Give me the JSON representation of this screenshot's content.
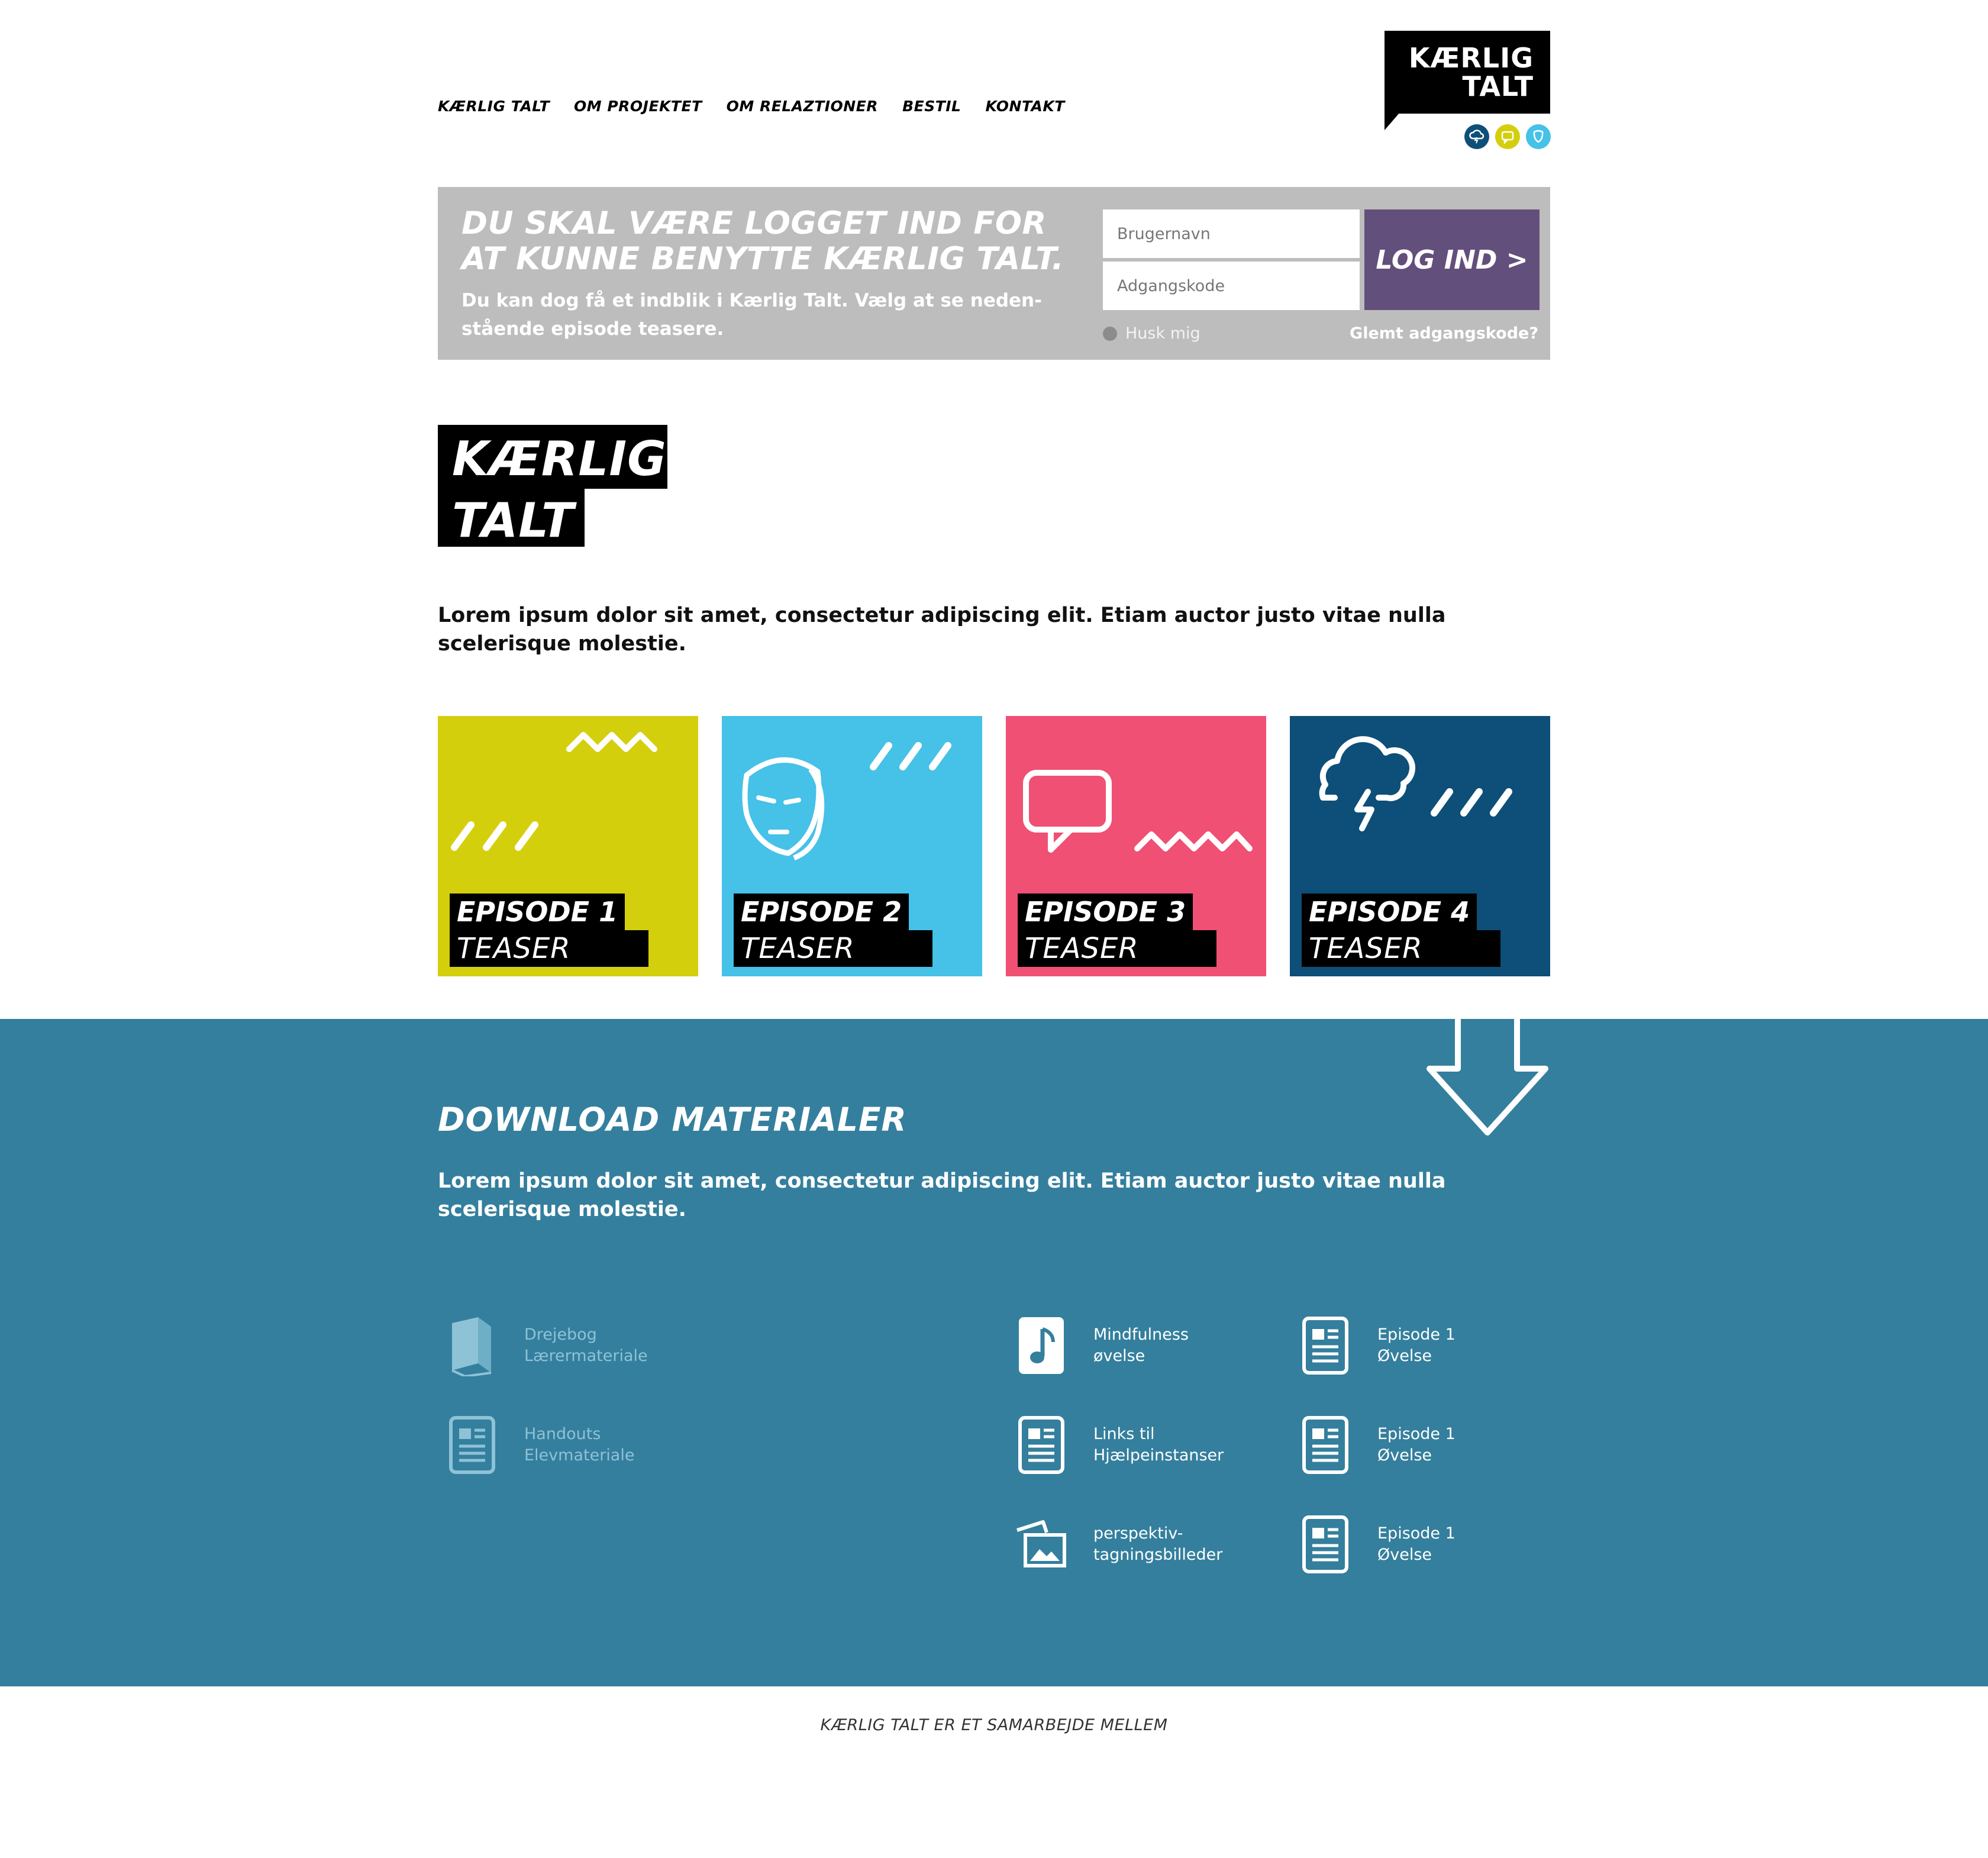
{
  "nav": {
    "items": [
      "KÆRLIG TALT",
      "OM PROJEKTET",
      "OM RELAZTIONER",
      "BESTIL",
      "KONTAKT"
    ]
  },
  "logo": {
    "line1": "KÆRLIG",
    "line2": "TALT"
  },
  "top_icons": [
    {
      "name": "cloud-storm-icon",
      "color": "#0d4f78"
    },
    {
      "name": "speech-bubble-icon",
      "color": "#d4cf0c"
    },
    {
      "name": "mask-icon",
      "color": "#46c1e8"
    }
  ],
  "login": {
    "heading": "DU SKAL VÆRE LOGGET IND FOR AT KUNNE BENYTTE KÆRLIG TALT.",
    "subtext": "Du kan dog få et indblik i Kærlig Talt. Vælg at se neden-stående episode teasere.",
    "username_placeholder": "Brugernavn",
    "password_placeholder": "Adgangskode",
    "button_label": "LOG IND >",
    "remember_label": "Husk mig",
    "forgot_label": "Glemt adgangskode?",
    "panel_color": "#bdbdbd",
    "button_color": "#634f7b"
  },
  "intro": {
    "text": "Lorem ipsum dolor sit amet, consectetur adipiscing elit. Etiam auctor justo vitae nulla scelerisque molestie."
  },
  "episodes": [
    {
      "title": "EPISODE 1",
      "subtitle": "TEASER",
      "color": "#d4cf0c",
      "icon": "zigzag-icon"
    },
    {
      "title": "EPISODE 2",
      "subtitle": "TEASER",
      "color": "#46c1e8",
      "icon": "mask-icon"
    },
    {
      "title": "EPISODE 3",
      "subtitle": "TEASER",
      "color": "#ef5073",
      "icon": "speech-bubble-icon"
    },
    {
      "title": "EPISODE 4",
      "subtitle": "TEASER",
      "color": "#0d4f78",
      "icon": "cloud-storm-icon"
    }
  ],
  "download": {
    "title": "DOWNLOAD MATERIALER",
    "text": "Lorem ipsum dolor sit amet, consectetur adipiscing elit. Etiam auctor justo vitae nulla scelerisque molestie.",
    "bg_color": "#347f9d",
    "resources": [
      {
        "line1": "Drejebog",
        "line2": "Lærermateriale",
        "icon": "book-icon",
        "enabled": false
      },
      {
        "line1": "Handouts",
        "line2": "Elevmateriale",
        "icon": "document-icon",
        "enabled": false
      },
      {
        "line1": "Mindfulness",
        "line2": "øvelse",
        "icon": "music-note-icon",
        "enabled": true
      },
      {
        "line1": "Links til",
        "line2": "Hjælpeinstanser",
        "icon": "document-icon",
        "enabled": true
      },
      {
        "line1": "perspektiv-",
        "line2": "tagningsbilleder",
        "icon": "photos-icon",
        "enabled": true
      },
      {
        "line1": "Episode 1",
        "line2": "Øvelse",
        "icon": "document-icon",
        "enabled": true
      },
      {
        "line1": "Episode 1",
        "line2": "Øvelse",
        "icon": "document-icon",
        "enabled": true
      },
      {
        "line1": "Episode 1",
        "line2": "Øvelse",
        "icon": "document-icon",
        "enabled": true
      }
    ]
  },
  "footer": {
    "text": "KÆRLIG TALT ER ET SAMARBEJDE MELLEM"
  }
}
